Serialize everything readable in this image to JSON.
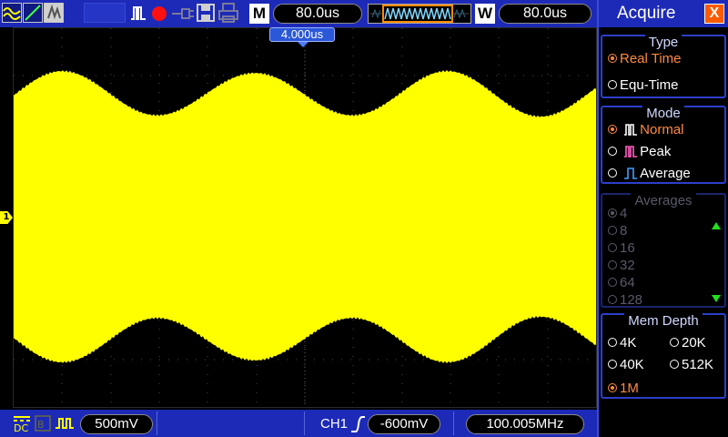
{
  "topbar": {
    "mode_label": "M",
    "main_timebase": "80.0us",
    "window_label": "W",
    "window_timebase": "80.0us"
  },
  "screen": {
    "trigger_time": "4.000us",
    "channel_marker": "1"
  },
  "bottombar": {
    "ch1_scale": "500mV",
    "trigger_source": "CH1",
    "trigger_level": "-600mV",
    "frequency": "100.005MHz"
  },
  "menu": {
    "title": "Acquire",
    "close_label": "X",
    "type": {
      "header": "Type",
      "options": [
        "Real Time",
        "Equ-Time"
      ],
      "selected": 0
    },
    "mode": {
      "header": "Mode",
      "options": [
        "Normal",
        "Peak",
        "Average"
      ],
      "selected": 0
    },
    "averages": {
      "header": "Averages",
      "options": [
        "4",
        "8",
        "16",
        "32",
        "64",
        "128"
      ],
      "selected": 0
    },
    "mem_depth": {
      "header": "Mem Depth",
      "options": [
        "4K",
        "20K",
        "40K",
        "512K",
        "1M"
      ],
      "selected": 4
    }
  },
  "colors": {
    "trace": "#ffff00",
    "bar": "#1d2ab8",
    "accent": "#ff8a3d",
    "grid": "#4a4a4a"
  }
}
